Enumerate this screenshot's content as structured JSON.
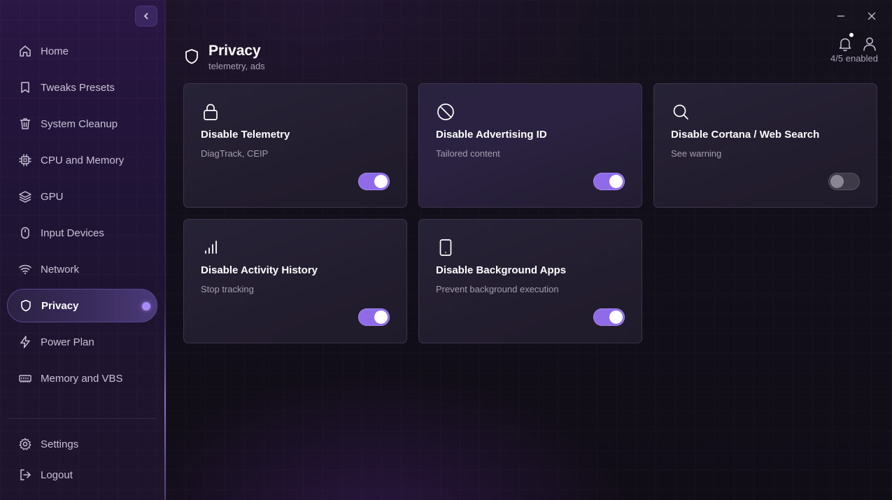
{
  "sidebar": {
    "items": [
      {
        "label": "Home",
        "icon": "home-icon"
      },
      {
        "label": "Tweaks Presets",
        "icon": "bookmark-icon"
      },
      {
        "label": "System Cleanup",
        "icon": "trash-icon"
      },
      {
        "label": "CPU and Memory",
        "icon": "cpu-icon"
      },
      {
        "label": "GPU",
        "icon": "layers-icon"
      },
      {
        "label": "Input Devices",
        "icon": "mouse-icon"
      },
      {
        "label": "Network",
        "icon": "wifi-icon"
      },
      {
        "label": "Privacy",
        "icon": "shield-icon",
        "active": true
      },
      {
        "label": "Power Plan",
        "icon": "lightning-icon"
      },
      {
        "label": "Memory and VBS",
        "icon": "memory-icon"
      }
    ],
    "bottom": [
      {
        "label": "Settings",
        "icon": "gear-icon"
      },
      {
        "label": "Logout",
        "icon": "logout-icon"
      }
    ]
  },
  "header": {
    "title": "Privacy",
    "subtitle": "telemetry, ads",
    "enabled_count": "4/5 enabled"
  },
  "cards": [
    {
      "title": "Disable Telemetry",
      "desc": "DiagTrack, CEIP",
      "icon": "lock-icon",
      "enabled": true
    },
    {
      "title": "Disable Advertising ID",
      "desc": "Tailored content",
      "icon": "block-icon",
      "enabled": true
    },
    {
      "title": "Disable Cortana / Web Search",
      "desc": "See warning",
      "icon": "search-icon",
      "enabled": false
    },
    {
      "title": "Disable Activity History",
      "desc": "Stop tracking",
      "icon": "bar-chart-icon",
      "enabled": true
    },
    {
      "title": "Disable Background Apps",
      "desc": "Prevent background execution",
      "icon": "tablet-icon",
      "enabled": true
    }
  ],
  "colors": {
    "accent": "#8f6be8",
    "active_dot": "#a88bf6",
    "toggle_off": "#3e3a48"
  }
}
